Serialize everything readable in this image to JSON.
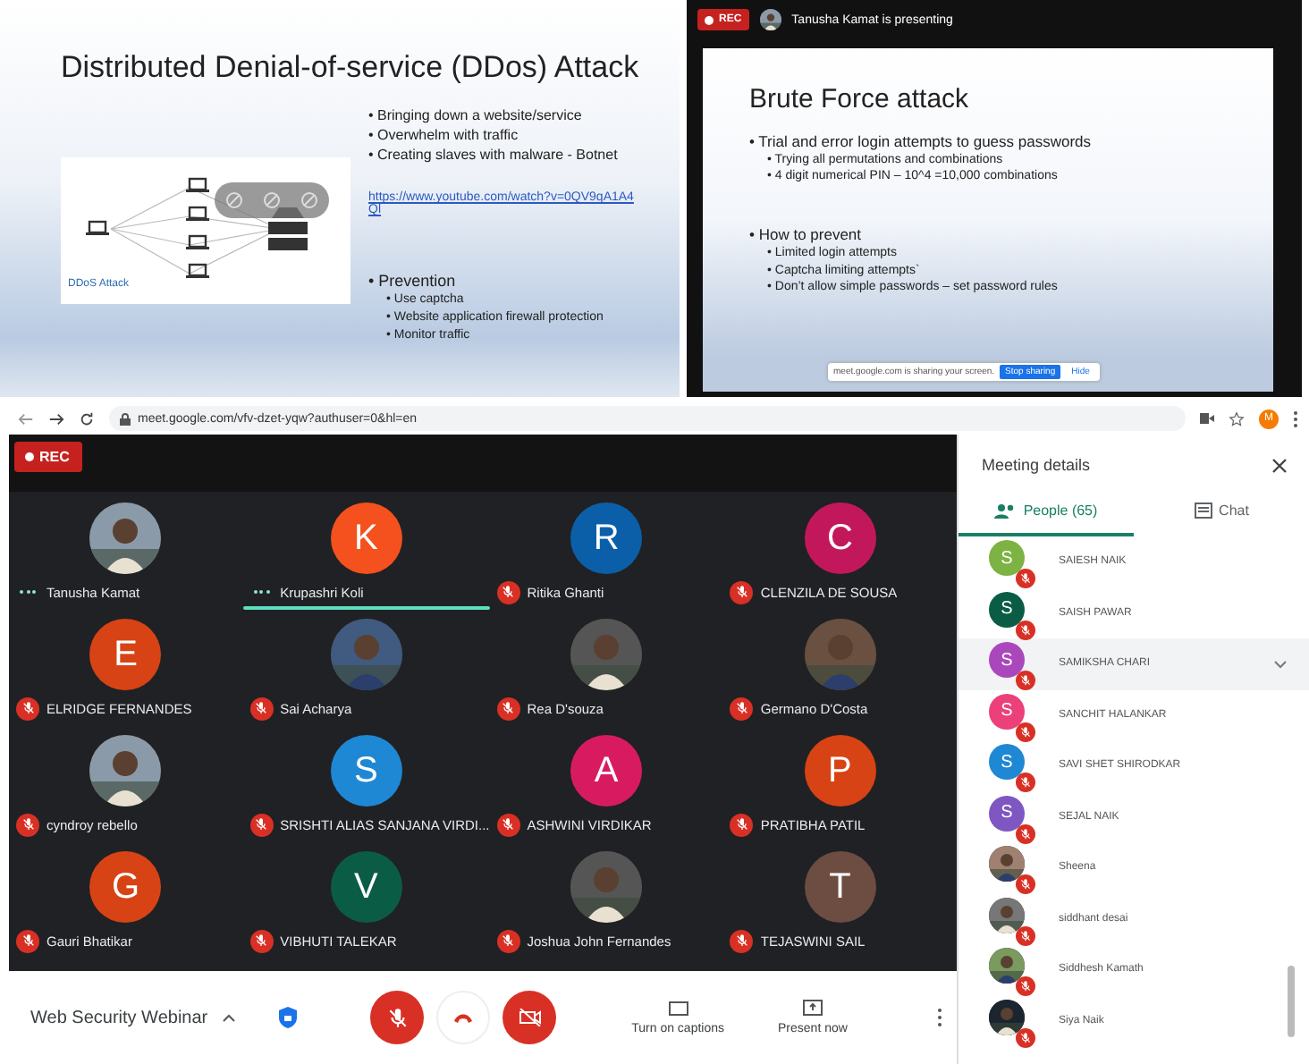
{
  "ddos_slide": {
    "title": "Distributed Denial-of-service (DDos) Attack",
    "bullets": [
      "• Bringing down a website/service",
      "• Overwhelm with traffic",
      "• Creating slaves with malware - Botnet"
    ],
    "link": "https://www.youtube.com/watch?v=0QV9qA1A4Ql",
    "diagram_caption": "DDoS Attack",
    "prevention": {
      "heading": "• Prevention",
      "items": [
        "• Use captcha",
        "• Website application firewall protection",
        "• Monitor traffic"
      ]
    }
  },
  "presentation": {
    "rec": "REC",
    "presenter": "Tanusha Kamat is presenting",
    "title": "Brute Force attack",
    "bullets": [
      {
        "text": "• Trial and error login attempts to guess passwords",
        "children": [
          {
            "text": "• Trying all permutations and combinations"
          },
          {
            "text": "• 4 digit numerical PIN – 10^4 =10,000 combinations"
          }
        ]
      },
      {
        "text": "• How to prevent",
        "children": [
          {
            "text": "• Limited login attempts"
          },
          {
            "text": "• Captcha limiting attempts`"
          },
          {
            "text": "• Don’t allow simple passwords – set password rules"
          }
        ]
      }
    ],
    "share_bar": {
      "message": "meet.google.com is sharing your screen.",
      "stop": "Stop sharing",
      "hide": "Hide"
    }
  },
  "browser": {
    "url": "meet.google.com/vfv-dzet-yqw?authuser=0&hl=en",
    "profile_initial": "M"
  },
  "meeting": {
    "rec": "REC",
    "tiles": [
      {
        "name": "Tanusha Kamat",
        "kind": "picture",
        "muted": false,
        "speaking": true,
        "highlighted": false
      },
      {
        "name": "Krupashri Koli",
        "kind": "letter",
        "letter": "K",
        "color": "#f4511e",
        "muted": false,
        "speaking": true,
        "highlighted": true
      },
      {
        "name": "Ritika Ghanti",
        "kind": "letter",
        "letter": "R",
        "color": "#0b5fa8",
        "muted": true,
        "speaking": false,
        "highlighted": false
      },
      {
        "name": "CLENZILA DE SOUSA",
        "kind": "letter",
        "letter": "C",
        "color": "#c2185b",
        "muted": true,
        "speaking": false,
        "highlighted": false
      },
      {
        "name": "ELRIDGE FERNANDES",
        "kind": "letter",
        "letter": "E",
        "color": "#d84315",
        "muted": true,
        "speaking": false,
        "highlighted": false
      },
      {
        "name": "Sai Acharya",
        "kind": "picture",
        "muted": true,
        "speaking": false,
        "highlighted": false
      },
      {
        "name": "Rea D'souza",
        "kind": "picture",
        "muted": true,
        "speaking": false,
        "highlighted": false
      },
      {
        "name": "Germano D'Costa",
        "kind": "picture",
        "muted": true,
        "speaking": false,
        "highlighted": false
      },
      {
        "name": "cyndroy rebello",
        "kind": "picture",
        "muted": true,
        "speaking": false,
        "highlighted": false
      },
      {
        "name": "SRISHTI ALIAS SANJANA VIRDI...",
        "kind": "letter",
        "letter": "S",
        "color": "#1e88d4",
        "muted": true,
        "speaking": false,
        "highlighted": false
      },
      {
        "name": "ASHWINI VIRDIKAR",
        "kind": "letter",
        "letter": "A",
        "color": "#d81b60",
        "muted": true,
        "speaking": false,
        "highlighted": false
      },
      {
        "name": "PRATIBHA PATIL",
        "kind": "letter",
        "letter": "P",
        "color": "#d84315",
        "muted": true,
        "speaking": false,
        "highlighted": false
      },
      {
        "name": "Gauri Bhatikar",
        "kind": "letter",
        "letter": "G",
        "color": "#d84315",
        "muted": true,
        "speaking": false,
        "highlighted": false
      },
      {
        "name": "VIBHUTI TALEKAR",
        "kind": "letter",
        "letter": "V",
        "color": "#0b5c45",
        "muted": true,
        "speaking": false,
        "highlighted": false
      },
      {
        "name": "Joshua John Fernandes",
        "kind": "picture",
        "muted": true,
        "speaking": false,
        "highlighted": false
      },
      {
        "name": "TEJASWINI SAIL",
        "kind": "letter",
        "letter": "T",
        "color": "#6d4c41",
        "muted": true,
        "speaking": false,
        "highlighted": false
      }
    ],
    "bottom_bar": {
      "meeting_title": "Web Security Webinar",
      "captions": "Turn on captions",
      "present": "Present now"
    }
  },
  "sidebar": {
    "title": "Meeting details",
    "tabs": [
      {
        "label": "People (65)",
        "kind": "people",
        "selected": true
      },
      {
        "label": "Chat",
        "kind": "chat",
        "selected": false
      }
    ],
    "people": [
      {
        "name": "SAIESH NAIK",
        "kind": "letter",
        "letter": "S",
        "color": "#7cb342",
        "muted": true,
        "selected": false
      },
      {
        "name": "SAISH PAWAR",
        "kind": "letter",
        "letter": "S",
        "color": "#0b5c45",
        "muted": true,
        "selected": false
      },
      {
        "name": "SAMIKSHA CHARI",
        "kind": "letter",
        "letter": "S",
        "color": "#ab47bc",
        "muted": true,
        "selected": true
      },
      {
        "name": "SANCHIT HALANKAR",
        "kind": "letter",
        "letter": "S",
        "color": "#ec407a",
        "muted": true,
        "selected": false
      },
      {
        "name": "SAVI SHET SHIRODKAR",
        "kind": "letter",
        "letter": "S",
        "color": "#1e88d4",
        "muted": true,
        "selected": false
      },
      {
        "name": "SEJAL NAIK",
        "kind": "letter",
        "letter": "S",
        "color": "#7e57c2",
        "muted": true,
        "selected": false
      },
      {
        "name": "Sheena",
        "kind": "picture",
        "muted": true,
        "selected": false
      },
      {
        "name": "siddhant desai",
        "kind": "picture",
        "muted": true,
        "selected": false
      },
      {
        "name": "Siddhesh Kamath",
        "kind": "picture",
        "muted": true,
        "selected": false
      },
      {
        "name": "Siya Naik",
        "kind": "picture",
        "muted": true,
        "selected": false
      }
    ]
  }
}
